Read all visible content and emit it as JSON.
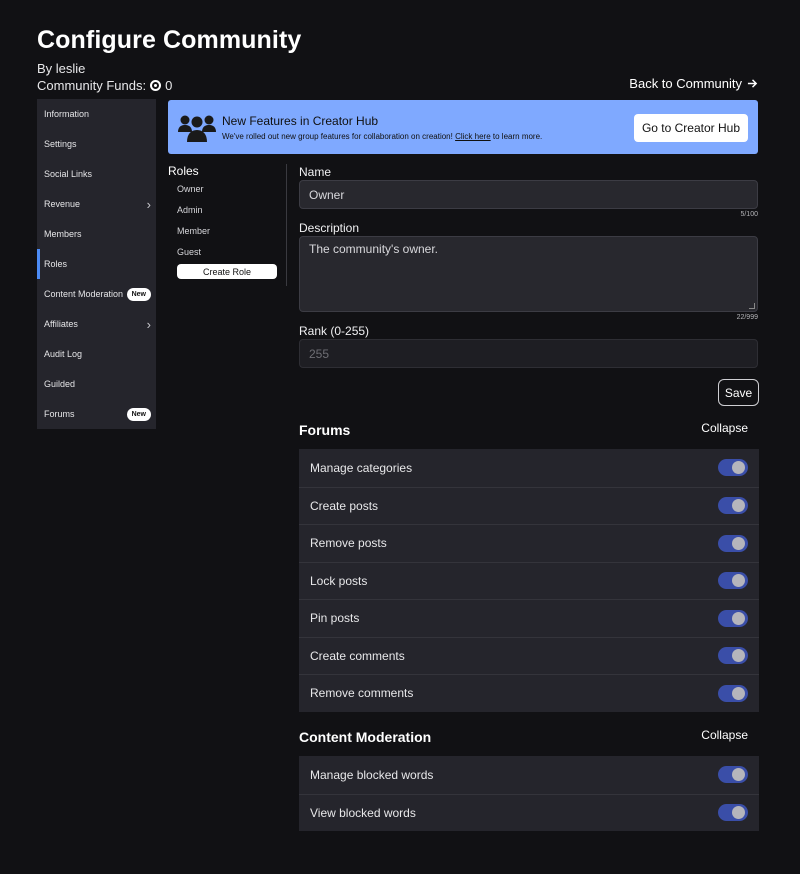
{
  "page": {
    "title": "Configure Community",
    "byline": "By leslie",
    "funds_label": "Community Funds:",
    "funds_value": "0",
    "back_link": "Back to Community"
  },
  "sidebar": {
    "items": [
      {
        "label": "Information"
      },
      {
        "label": "Settings"
      },
      {
        "label": "Social Links"
      },
      {
        "label": "Revenue",
        "chevron": true
      },
      {
        "label": "Members"
      },
      {
        "label": "Roles",
        "active": true
      },
      {
        "label": "Content Moderation",
        "badge": "New"
      },
      {
        "label": "Affiliates",
        "chevron": true
      },
      {
        "label": "Audit Log"
      },
      {
        "label": "Guilded"
      },
      {
        "label": "Forums",
        "badge": "New"
      }
    ]
  },
  "banner": {
    "title": "New Features in Creator Hub",
    "text_before": "We've rolled out new group features for collaboration on creation!",
    "link": "Click here",
    "text_after": "to learn more.",
    "button": "Go to Creator Hub",
    "color": "#7fa9ff"
  },
  "roles": {
    "heading": "Roles",
    "items": [
      "Owner",
      "Admin",
      "Member",
      "Guest"
    ],
    "create_button": "Create Role"
  },
  "form": {
    "name_label": "Name",
    "name_value": "Owner",
    "name_count": "5/100",
    "description_label": "Description",
    "description_value": "The community's owner.",
    "description_count": "22/999",
    "rank_label": "Rank (0-255)",
    "rank_placeholder": "255",
    "save_button": "Save"
  },
  "sections": {
    "forums": {
      "title": "Forums",
      "collapse": "Collapse",
      "permissions": [
        {
          "label": "Manage categories",
          "enabled": true
        },
        {
          "label": "Create posts",
          "enabled": true
        },
        {
          "label": "Remove posts",
          "enabled": true
        },
        {
          "label": "Lock posts",
          "enabled": true
        },
        {
          "label": "Pin posts",
          "enabled": true
        },
        {
          "label": "Create comments",
          "enabled": true
        },
        {
          "label": "Remove comments",
          "enabled": true
        }
      ]
    },
    "moderation": {
      "title": "Content Moderation",
      "collapse": "Collapse",
      "permissions": [
        {
          "label": "Manage blocked words",
          "enabled": true
        },
        {
          "label": "View blocked words",
          "enabled": true
        }
      ]
    }
  },
  "colors": {
    "background": "#111114",
    "panel": "#25252c",
    "accent": "#4c8bf5",
    "toggle_on": "#3a4ea8"
  }
}
